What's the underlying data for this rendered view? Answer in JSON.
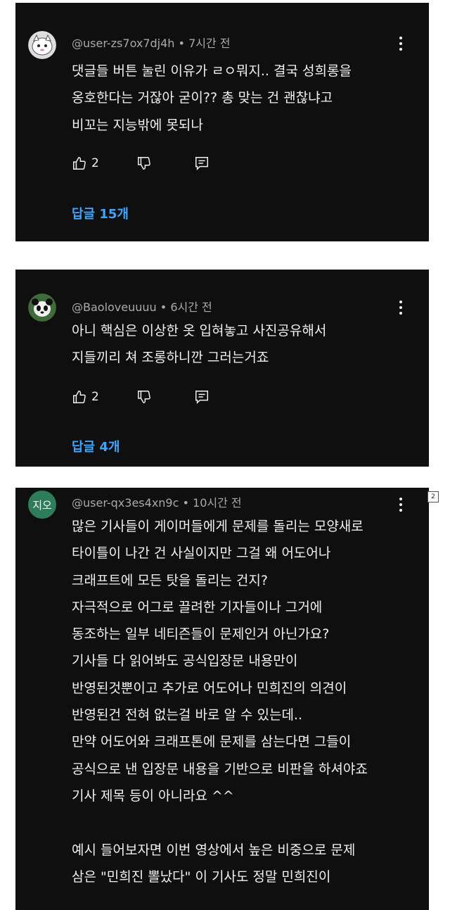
{
  "comments": [
    {
      "author": "@user-zs7ox7dj4h",
      "time": "7시간 전",
      "lines": [
        "댓글들 버튼 눌린 이유가 ㄹㅇ뭐지.. 결국 성희롱을",
        "옹호한다는 거잖아 굳이?? 총 맞는 건 괜찮냐고",
        "비꼬는 지능밖에 못되나"
      ],
      "likes": "2",
      "replies": "답글 15개",
      "avatar_icon": "cartoon-avatar-icon"
    },
    {
      "author": "@Baoloveuuuu",
      "time": "6시간 전",
      "lines": [
        "아니 핵심은 이상한 옷 입혀놓고 사진공유해서",
        "지들끼리 쳐 조롱하니깐 그러는거죠"
      ],
      "likes": "2",
      "replies": "답글 4개",
      "avatar_icon": "panda-avatar-icon"
    },
    {
      "author": "@user-qx3es4xn9c",
      "time": "10시간 전",
      "avatar_text": "지오",
      "avatar_color": "#2e7d59",
      "lines": [
        "많은 기사들이 게이머들에게 문제를 돌리는 모양새로",
        "타이틀이 나간 건 사실이지만 그걸 왜 어도어나",
        "크래프트에 모든 탓을 돌리는 건지?",
        "자극적으로 어그로 끌려한 기자들이나 그거에",
        "동조하는 일부 네티즌들이 문제인거 아닌가요?",
        "기사들 다 읽어봐도 공식입장문 내용만이",
        "반영된것뿐이고 추가로 어도어나 민희진의 의견이",
        "반영된건 전혀 없는걸 바로 알 수 있는데..",
        "만약 어도어와 크래프톤에 문제를 삼는다면 그들이",
        "공식으로 낸 입장문 내용을 기반으로 비판을 하셔야죠",
        "기사 제목 등이 아니라요 ^^",
        "",
        "예시 들어보자면 이번 영상에서 높은 비중으로 문제",
        "삼은 \"민희진 뽈났다\" 이 기사도 정말 민희진이"
      ]
    }
  ],
  "page_badge": "2",
  "colors": {
    "card_bg": "#0f0f0f",
    "link_blue": "#3ea6ff",
    "meta_gray": "#aaaaaa"
  }
}
